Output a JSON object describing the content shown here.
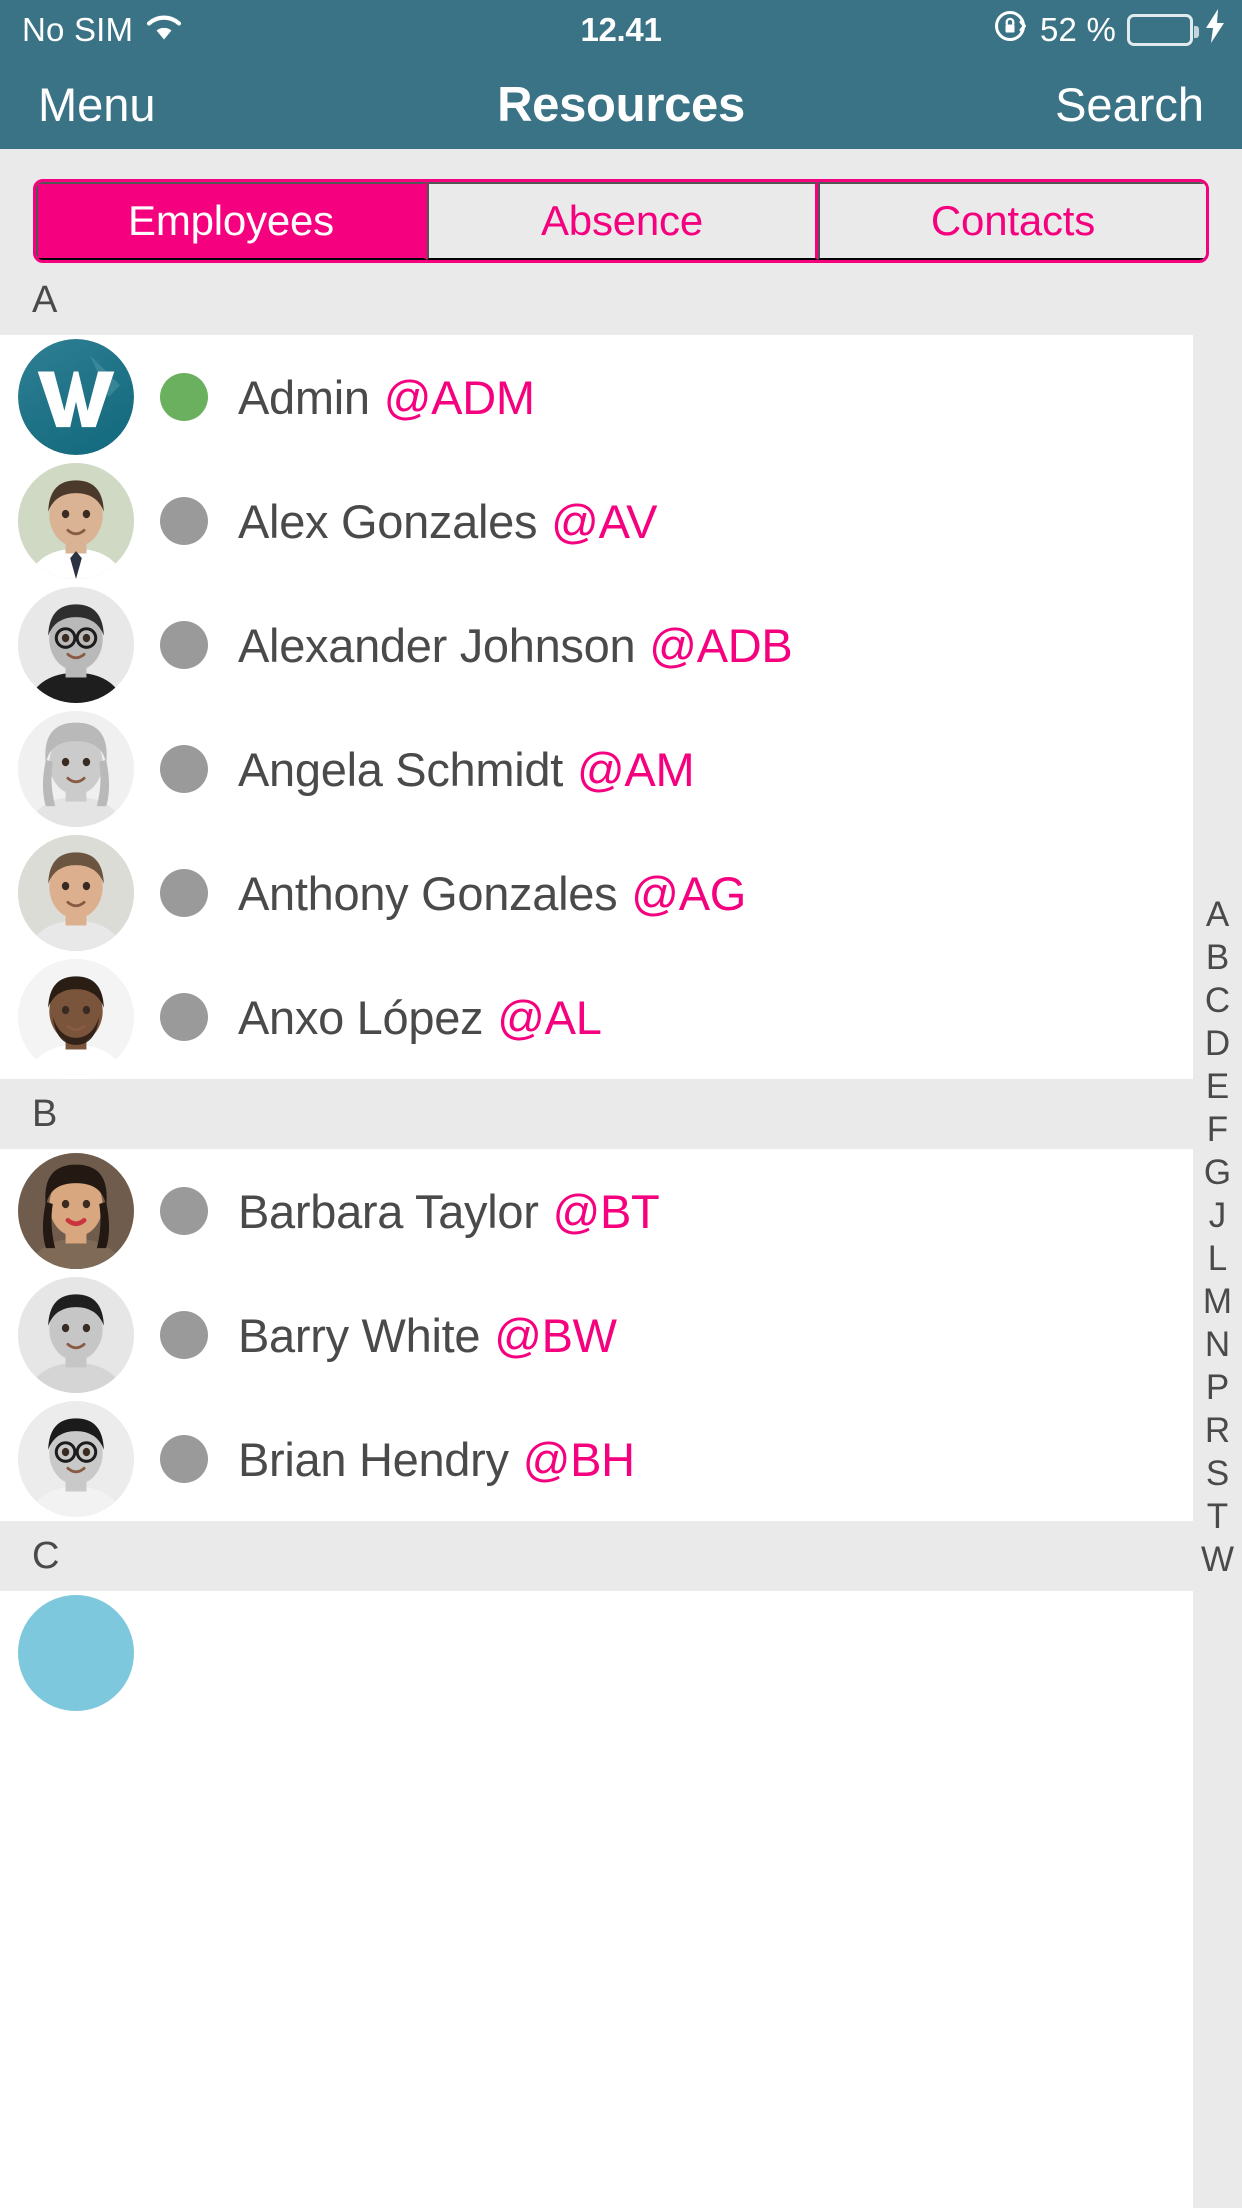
{
  "status_bar": {
    "carrier": "No SIM",
    "wifi_icon": "wifi-icon",
    "time": "12.41",
    "rotation_lock_icon": "rotation-lock-icon",
    "battery_percent": "52 %",
    "battery_level": 52,
    "battery_icon": "battery-icon",
    "charging_icon": "lightning-bolt-icon",
    "bar_color": "#3a7385",
    "battery_fill_color": "#4cd764"
  },
  "nav_bar": {
    "menu_label": "Menu",
    "title": "Resources",
    "search_label": "Search",
    "background_color": "#3a7385",
    "text_color": "#ffffff"
  },
  "segmented_control": {
    "accent_color": "#f5007e",
    "selected_index": 0,
    "items": [
      {
        "label": "Employees",
        "selected": true
      },
      {
        "label": "Absence",
        "selected": false
      },
      {
        "label": "Contacts",
        "selected": false
      }
    ]
  },
  "list": {
    "handle_color": "#f5007e",
    "name_color": "#4a4a4a",
    "status_online_color": "#6bb05f",
    "status_offline_color": "#9a9a9a",
    "sections": [
      {
        "letter": "A",
        "rows": [
          {
            "name": "Admin",
            "handle": "@ADM",
            "status": "online",
            "avatar": "logo-w-avatar"
          },
          {
            "name": "Alex Gonzales",
            "handle": "@AV",
            "status": "offline",
            "avatar": "photo-avatar-man-suit"
          },
          {
            "name": "Alexander Johnson",
            "handle": "@ADB",
            "status": "offline",
            "avatar": "photo-avatar-man-glasses"
          },
          {
            "name": "Angela Schmidt",
            "handle": "@AM",
            "status": "offline",
            "avatar": "photo-avatar-woman-blonde"
          },
          {
            "name": "Anthony Gonzales",
            "handle": "@AG",
            "status": "offline",
            "avatar": "photo-avatar-man-smiling"
          },
          {
            "name": "Anxo López",
            "handle": "@AL",
            "status": "offline",
            "avatar": "photo-avatar-man-beard"
          }
        ]
      },
      {
        "letter": "B",
        "rows": [
          {
            "name": "Barbara Taylor",
            "handle": "@BT",
            "status": "offline",
            "avatar": "photo-avatar-woman-dark-hair"
          },
          {
            "name": "Barry White",
            "handle": "@BW",
            "status": "offline",
            "avatar": "photo-avatar-man-curly"
          },
          {
            "name": "Brian Hendry",
            "handle": "@BH",
            "status": "offline",
            "avatar": "photo-avatar-man-dark-glasses"
          }
        ]
      },
      {
        "letter": "C",
        "rows": [
          {
            "name": "",
            "handle": "",
            "status": "offline",
            "avatar": "photo-avatar-partial-blue"
          }
        ]
      }
    ]
  },
  "index_strip": {
    "letters": [
      "A",
      "B",
      "C",
      "D",
      "E",
      "F",
      "G",
      "J",
      "L",
      "M",
      "N",
      "P",
      "R",
      "S",
      "T",
      "W"
    ],
    "background_color": "#eaeaea",
    "text_color": "#4a4a4a"
  }
}
